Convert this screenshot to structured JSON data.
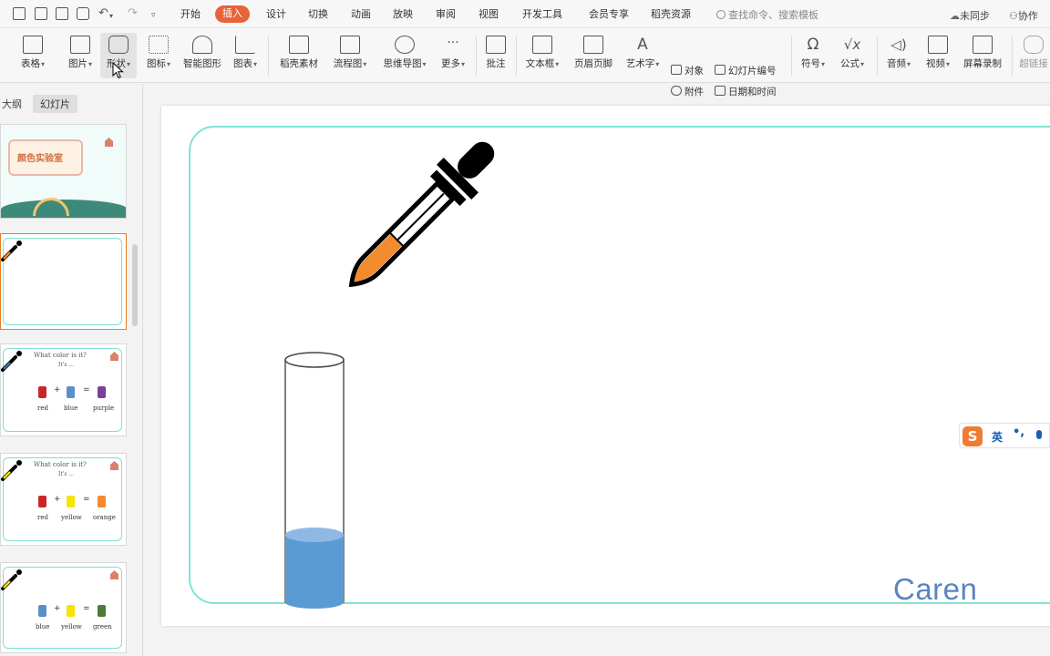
{
  "menubar": {
    "tabs": [
      {
        "label": "开始",
        "active": false
      },
      {
        "label": "插入",
        "active": true
      },
      {
        "label": "设计",
        "active": false
      },
      {
        "label": "切换",
        "active": false
      },
      {
        "label": "动画",
        "active": false
      },
      {
        "label": "放映",
        "active": false
      },
      {
        "label": "审阅",
        "active": false
      },
      {
        "label": "视图",
        "active": false
      },
      {
        "label": "开发工具",
        "active": false
      },
      {
        "label": "会员专享",
        "active": false
      },
      {
        "label": "稻壳资源",
        "active": false
      }
    ],
    "search_placeholder": "查找命令、搜索模板",
    "sync_label": "未同步",
    "collab_label": "协作",
    "accent_color": "#e8623a"
  },
  "ribbon": {
    "buttons": {
      "table": "表格",
      "picture": "图片",
      "shape": "形状",
      "icon": "图标",
      "smartart": "智能图形",
      "chart": "图表",
      "docer": "稻壳素材",
      "flowchart": "流程图",
      "mindmap": "思维导图",
      "more": "更多",
      "comment": "批注",
      "textbox": "文本框",
      "headerfooter": "页眉页脚",
      "wordart": "艺术字",
      "symbol": "符号",
      "formula": "公式",
      "audio": "音频",
      "video": "视频",
      "screenrec": "屏幕录制",
      "hyperlink": "超链接"
    },
    "small": {
      "object": "对象",
      "slide_number": "幻灯片编号",
      "attachment": "附件",
      "datetime": "日期和时间"
    }
  },
  "left_panel": {
    "tab_outline": "大纲",
    "tab_slides": "幻灯片",
    "thumb1_title": "颜色实验室",
    "thumbs": [
      {
        "question": "What color is it?",
        "answer": "It's ...",
        "c1": "red",
        "c2": "blue",
        "c3": "purple",
        "col1": "#c62828",
        "col2": "#5b8fc9",
        "col3": "#7b3f9e",
        "dropper": "#3a6fb0"
      },
      {
        "question": "What color is it?",
        "answer": "It's ...",
        "c1": "red",
        "c2": "yellow",
        "c3": "orange",
        "col1": "#c62828",
        "col2": "#f5e400",
        "col3": "#f28a2e",
        "dropper": "#f5e400"
      },
      {
        "question": "",
        "answer": "",
        "c1": "blue",
        "c2": "yellow",
        "c3": "green",
        "col1": "#5b8fc9",
        "col2": "#f5e400",
        "col3": "#4f7a3a",
        "dropper": "#f5e400"
      }
    ]
  },
  "slide": {
    "watermark": "Caren",
    "frame_color": "#7fe3d4",
    "dropper_liquid_color": "#f28a2e",
    "tube_liquid_color": "#5b9bd5",
    "tube_fill_level": 0.28
  },
  "ime": {
    "logo": "S",
    "lang": "英",
    "punct": "•,"
  }
}
